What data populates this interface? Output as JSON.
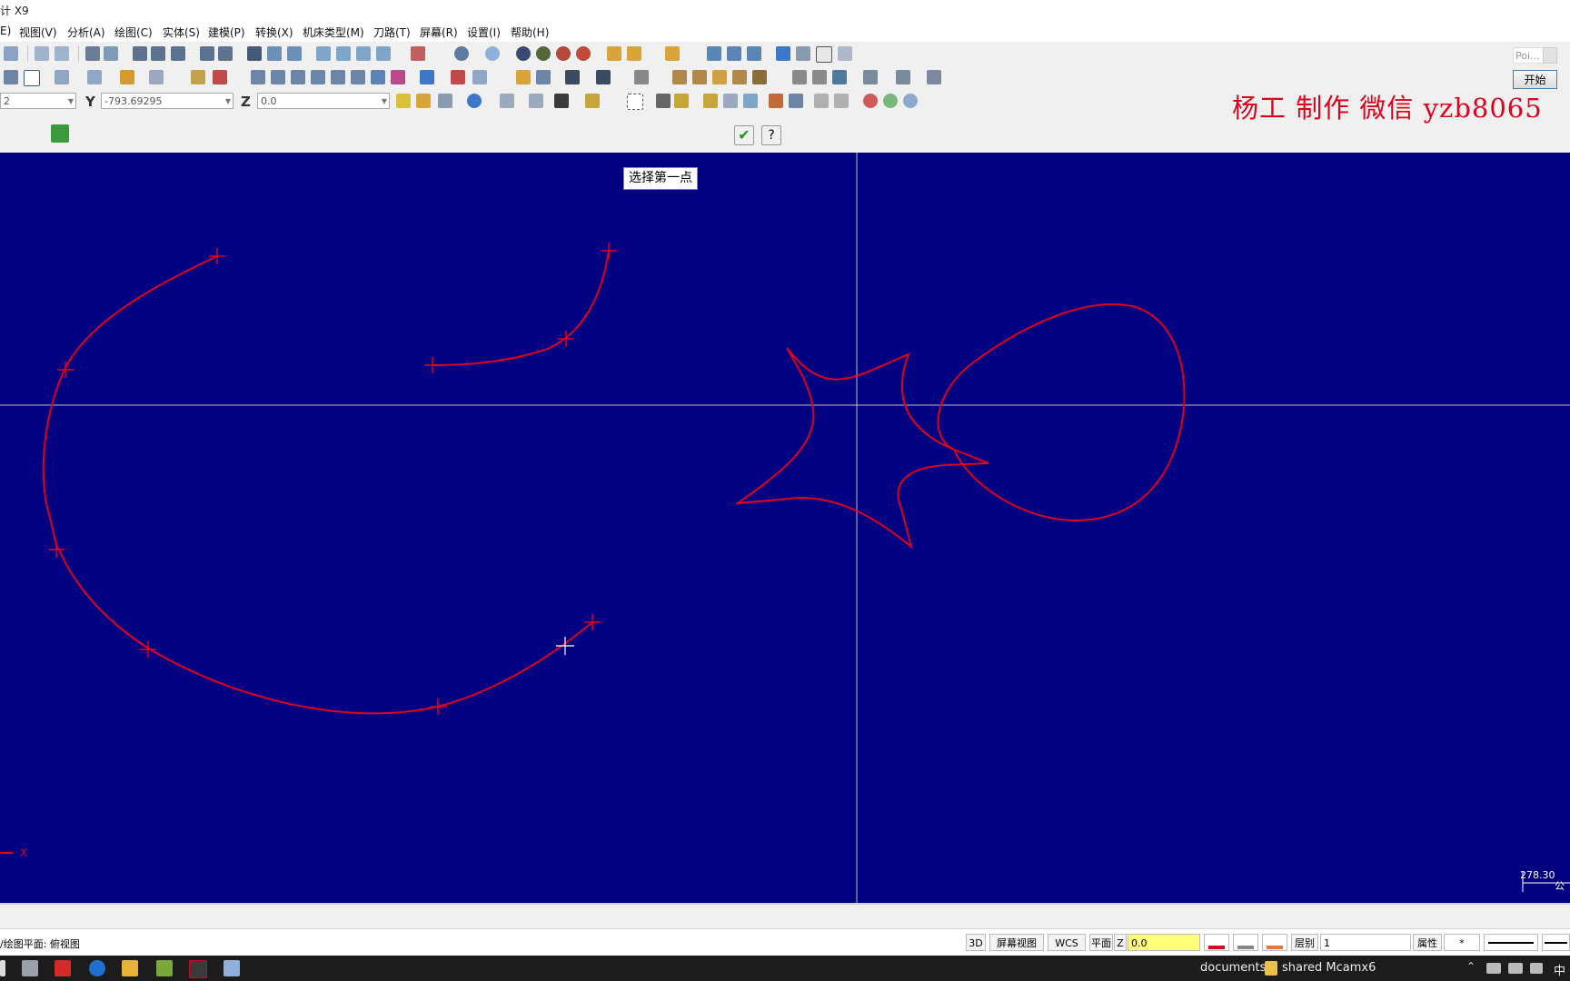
{
  "window": {
    "title_fragment": "计 X9"
  },
  "menu": [
    "E)",
    "视图(V)",
    "分析(A)",
    "绘图(C)",
    "实体(S)",
    "建模(P)",
    "转换(X)",
    "机床类型(M)",
    "刀路(T)",
    "屏幕(R)",
    "设置(I)",
    "帮助(H)"
  ],
  "coords": {
    "x_value": "2",
    "y_label": "Y",
    "y_value": "-793.69295",
    "z_label": "Z",
    "z_value": "0.0"
  },
  "watermark": "杨工 制作 微信 yzb8065",
  "start_button": "开始",
  "search_placeholder": "Poi...",
  "prompt": "选择第一点",
  "axis_marker": "X",
  "scale": {
    "value": "278.30",
    "unit": "公"
  },
  "status": {
    "plane_text": "/绘图平面: 俯视图",
    "btn_3d": "3D",
    "btn_screen_view": "屏幕视图",
    "btn_wcs": "WCS",
    "btn_plane": "平面",
    "z_label": "Z",
    "z_value": "0.0",
    "level_label": "层别",
    "level_value": "1",
    "attr_label": "属性",
    "point_style": "*"
  },
  "taskbar": {
    "documents": "documents",
    "shared": "shared Mcamx6",
    "lang": "中"
  },
  "colors": {
    "viewport_bg": "#000080",
    "curve": "#e0001b",
    "crosshair": "#bfbfbf",
    "watermark": "#e0001b"
  }
}
